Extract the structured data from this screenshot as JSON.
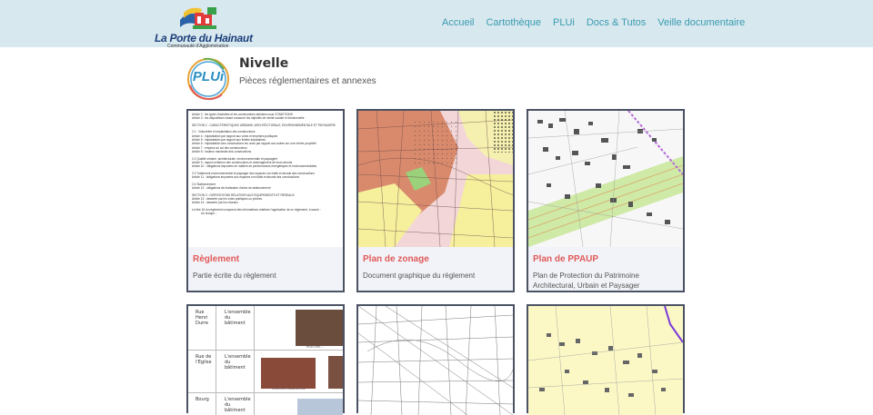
{
  "header": {
    "logo_text": "La Porte du Hainaut",
    "logo_sub": "Communauté d'Agglomération",
    "nav": [
      "Accueil",
      "Cartothèque",
      "PLUi",
      "Docs & Tutos",
      "Veille documentaire"
    ]
  },
  "page": {
    "logo_label": "PLUi",
    "commune": "Nivelle",
    "subtitle": "Pièces réglementaires et annexes"
  },
  "cards": [
    {
      "title": "Règlement",
      "desc": "Partie écrite du règlement"
    },
    {
      "title": "Plan de zonage",
      "desc": "Document graphique du règlement"
    },
    {
      "title": "Plan de PPAUP",
      "desc": "Plan de Protection du Patrimoine Architectural, Urbain et Paysager"
    }
  ],
  "reglement_lines": [
    "Article 2 : les types d'activités et les constructions admises sous CONDITIONS",
    "Article 3 : les dispositions visant à assurer les objectifs de mixité sociale et fonctionnelle",
    "SECTION 2 : CARACTÉRISTIQUES URBAINE, ARCHITECTURALE, ENVIRONNEMENTALE ET PAYSAGÈRE",
    "2.1 : Volumétrie et implantation des constructions",
    "Article 4 : implantation par rapport aux voies et emprises publiques",
    "Article 5 : implantation par rapport aux limites séparatives",
    "Article 6 : implantation des constructions les unes par rapport aux autres sur une même propriété",
    "Article 7 : emprise au sol des constructions",
    "Article 8 : hauteur maximale des constructions",
    "2.2 Qualité urbaine, architecturale, environnementale et paysagère",
    "Article 9 : aspect extérieur des constructions et aménagement de leurs abords",
    "Article 10 : obligations imposées en matière de performances énergétiques et environnementales",
    "2.3 Traitement environnemental et paysager des espaces non bâtis et abords des constructions",
    "Article 11 : obligations imposées aux espaces non bâtis et abords des constructions",
    "2.4 Stationnement",
    "Article 12 : obligations de réalisation d'aires de stationnement",
    "SECTION 3 : DISPOSITIONS RELATIVES AUX ÉQUIPEMENTS ET RÉSEAUX",
    "Article 13 : desserte par les voies publiques ou privées",
    "Article 14 : desserte par les réseaux",
    "Le titre 16 du règlement comprend des informations relatives l'application de ce règlement, à savoir :",
    "Un lexique ;"
  ],
  "patrimoine_rows": [
    {
      "street": "Rue Henri Durre",
      "scope": "L'ensemble du bâtiment",
      "caption": "Photo IMO ..."
    },
    {
      "street": "Rue de l'Eglise",
      "scope": "L'ensemble du bâtiment",
      "caption": "Photo IMO Vieille Blonde"
    },
    {
      "street": "Bourg",
      "scope": "L'ensemble du bâtiment",
      "caption": ""
    }
  ],
  "colors": {
    "header_bg": "#d7e8ef",
    "nav": "#3a9bb0",
    "accent": "#e05a5a",
    "card_border": "#4a5264"
  }
}
